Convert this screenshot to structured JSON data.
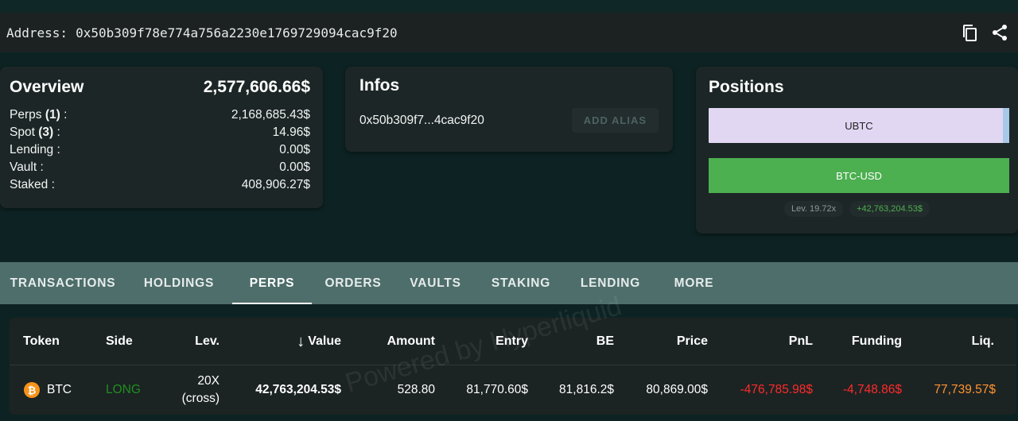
{
  "address_bar": {
    "label": "Address:",
    "address": "0x50b309f78e774a756a2230e1769729094cac9f20",
    "icons": [
      "copy-icon",
      "share-icon"
    ]
  },
  "overview": {
    "title": "Overview",
    "total": "2,577,606.66$",
    "rows": [
      {
        "label": "Perps",
        "count": "(1)",
        "suffix": " :",
        "value": "2,168,685.43$"
      },
      {
        "label": "Spot",
        "count": "(3)",
        "suffix": " :",
        "value": "14.96$"
      },
      {
        "label": "Lending",
        "count": "",
        "suffix": " :",
        "value": "0.00$"
      },
      {
        "label": "Vault",
        "count": "",
        "suffix": " :",
        "value": "0.00$"
      },
      {
        "label": "Staked",
        "count": "",
        "suffix": " :",
        "value": "408,906.27$"
      }
    ]
  },
  "infos": {
    "title": "Infos",
    "short_address": "0x50b309f7...4cac9f20",
    "add_alias_label": "ADD ALIAS"
  },
  "positions": {
    "title": "Positions",
    "items": [
      {
        "label": "UBTC",
        "color": "#e1d7f3"
      },
      {
        "label": "BTC-USD",
        "color": "#4caf50"
      }
    ],
    "leverage": "Lev. 19.72x",
    "pnl": "+42,763,204.53$"
  },
  "tabs": [
    {
      "label": "TRANSACTIONS",
      "active": false
    },
    {
      "label": "HOLDINGS",
      "active": false
    },
    {
      "label": "PERPS",
      "active": true
    },
    {
      "label": "ORDERS",
      "active": false
    },
    {
      "label": "VAULTS",
      "active": false
    },
    {
      "label": "STAKING",
      "active": false
    },
    {
      "label": "LENDING",
      "active": false
    },
    {
      "label": "MORE",
      "active": false
    }
  ],
  "table": {
    "headers": {
      "token": "Token",
      "side": "Side",
      "lev": "Lev.",
      "value_arrow": "↓",
      "value": "Value",
      "amount": "Amount",
      "entry": "Entry",
      "be": "BE",
      "price": "Price",
      "pnl": "PnL",
      "funding": "Funding",
      "liq": "Liq."
    },
    "rows": [
      {
        "token_icon": "bitcoin-icon",
        "token_glyph": "₿",
        "token": "BTC",
        "side": "LONG",
        "lev": "20X",
        "lev_mode": "(cross)",
        "value": "42,763,204.53$",
        "amount": "528.80",
        "entry": "81,770.60$",
        "be": "81,816.2$",
        "price": "80,869.00$",
        "pnl": "-476,785.98$",
        "funding": "-4,748.86$",
        "liq": "77,739.57$"
      }
    ]
  },
  "watermark": "Powered by Hyperliquid",
  "colors": {
    "background": "#0d2323",
    "card": "#1d2626",
    "tabs_bar": "#4e6e6b",
    "long": "#1f8f1f",
    "negative": "#ff2b2b",
    "liquidation": "#ff9430",
    "btc": "#f7931a"
  }
}
